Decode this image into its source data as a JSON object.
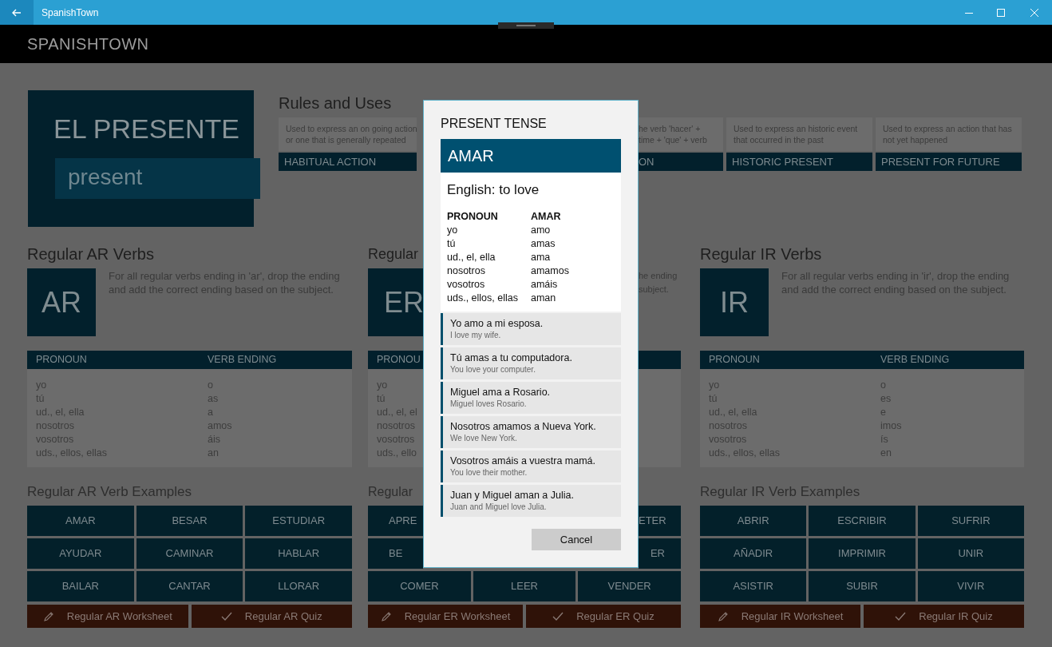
{
  "window": {
    "title": "SpanishTown"
  },
  "app_title": "SPANISHTOWN",
  "hero": {
    "title": "EL PRESENTE",
    "subtitle": "present"
  },
  "rules": {
    "title": "Rules and Uses",
    "cards": [
      {
        "kind": "full",
        "description": [
          "Used to express an on going action",
          "or one that is generally repeated"
        ],
        "label": "HABITUAL ACTION"
      },
      {
        "kind": "clipped",
        "description": [
          "he verb 'hacer' +",
          "time + 'que' + verb"
        ],
        "label": "ON"
      },
      {
        "kind": "full",
        "description": [
          "Used to express an historic event",
          "that occurred in the past"
        ],
        "label": "HISTORIC PRESENT"
      },
      {
        "kind": "full",
        "description": [
          "Used to express an action that has",
          "not yet happened"
        ],
        "label": "PRESENT FOR FUTURE"
      }
    ]
  },
  "verb_groups": [
    {
      "kind": "full",
      "title": "Regular AR Verbs",
      "tile": "AR",
      "description": "For all regular verbs ending in 'ar', drop the ending and add the correct ending based on the subject.",
      "headers": [
        "PRONOUN",
        "VERB ENDING"
      ],
      "rows": [
        [
          "yo",
          "o"
        ],
        [
          "tú",
          "as"
        ],
        [
          "ud., el, ella",
          "a"
        ],
        [
          "nosotros",
          "amos"
        ],
        [
          "vosotros",
          "áis"
        ],
        [
          "uds., ellos, ellas",
          "an"
        ]
      ],
      "examples_title": "Regular AR Verb Examples",
      "examples": [
        [
          "AMAR",
          "BESAR",
          "ESTUDIAR"
        ],
        [
          "AYUDAR",
          "CAMINAR",
          "HABLAR"
        ],
        [
          "BAILAR",
          "CANTAR",
          "LLORAR"
        ]
      ],
      "actions": [
        {
          "kind": "worksheet",
          "label": "Regular AR Worksheet"
        },
        {
          "kind": "quiz",
          "label": "Regular AR Quiz"
        }
      ]
    },
    {
      "kind": "clipped",
      "title": "Regular",
      "tile": "ER",
      "description": [
        "he ending",
        "subject."
      ],
      "headers": [
        "PRONOU"
      ],
      "rows": [
        [
          "yo"
        ],
        [
          "tú"
        ],
        [
          "ud., el, el"
        ],
        [
          "nosotros"
        ],
        [
          "vosotros"
        ],
        [
          "uds., ello"
        ]
      ],
      "examples_title": "Regular",
      "examples": [
        [
          "APRE",
          "ETER"
        ],
        [
          "BE",
          "ER"
        ],
        [
          "COMER",
          "LEER",
          "VENDER"
        ]
      ],
      "actions": [
        {
          "kind": "worksheet",
          "label": "Regular ER Worksheet"
        },
        {
          "kind": "quiz",
          "label": "Regular ER Quiz"
        }
      ]
    },
    {
      "kind": "full",
      "title": "Regular IR Verbs",
      "tile": "IR",
      "description": "For all regular verbs ending in 'ir', drop the ending and add the correct ending based on the subject.",
      "headers": [
        "PRONOUN",
        "VERB ENDING"
      ],
      "rows": [
        [
          "yo",
          "o"
        ],
        [
          "tú",
          "es"
        ],
        [
          "ud., el, ella",
          "e"
        ],
        [
          "nosotros",
          "imos"
        ],
        [
          "vosotros",
          "ís"
        ],
        [
          "uds., ellos, ellas",
          "en"
        ]
      ],
      "examples_title": "Regular IR Verb Examples",
      "examples": [
        [
          "ABRIR",
          "ESCRIBIR",
          "SUFRIR"
        ],
        [
          "AÑADIR",
          "IMPRIMIR",
          "UNIR"
        ],
        [
          "ASISTIR",
          "SUBIR",
          "VIVIR"
        ]
      ],
      "actions": [
        {
          "kind": "worksheet",
          "label": "Regular IR Worksheet"
        },
        {
          "kind": "quiz",
          "label": "Regular IR Quiz"
        }
      ]
    }
  ],
  "dialog": {
    "title": "PRESENT TENSE",
    "verb": "AMAR",
    "english": "English: to love",
    "headers": [
      "PRONOUN",
      "AMAR"
    ],
    "rows": [
      [
        "yo",
        "amo"
      ],
      [
        "tú",
        "amas"
      ],
      [
        "ud., el, ella",
        "ama"
      ],
      [
        "nosotros",
        "amamos"
      ],
      [
        "vosotros",
        "amáis"
      ],
      [
        "uds., ellos, ellas",
        "aman"
      ]
    ],
    "examples": [
      {
        "spanish": "Yo amo a mi esposa.",
        "english": "I love my wife."
      },
      {
        "spanish": "Tú amas a tu computadora.",
        "english": "You love your computer."
      },
      {
        "spanish": "Miguel ama a Rosario.",
        "english": "Miguel loves Rosario."
      },
      {
        "spanish": "Nosotros amamos a Nueva York.",
        "english": "We love New York."
      },
      {
        "spanish": "Vosotros amáis a vuestra mamá.",
        "english": "You love their mother."
      },
      {
        "spanish": "Juan y Miguel aman a Julia.",
        "english": "Juan and Miguel love Julia."
      }
    ],
    "cancel": "Cancel"
  }
}
